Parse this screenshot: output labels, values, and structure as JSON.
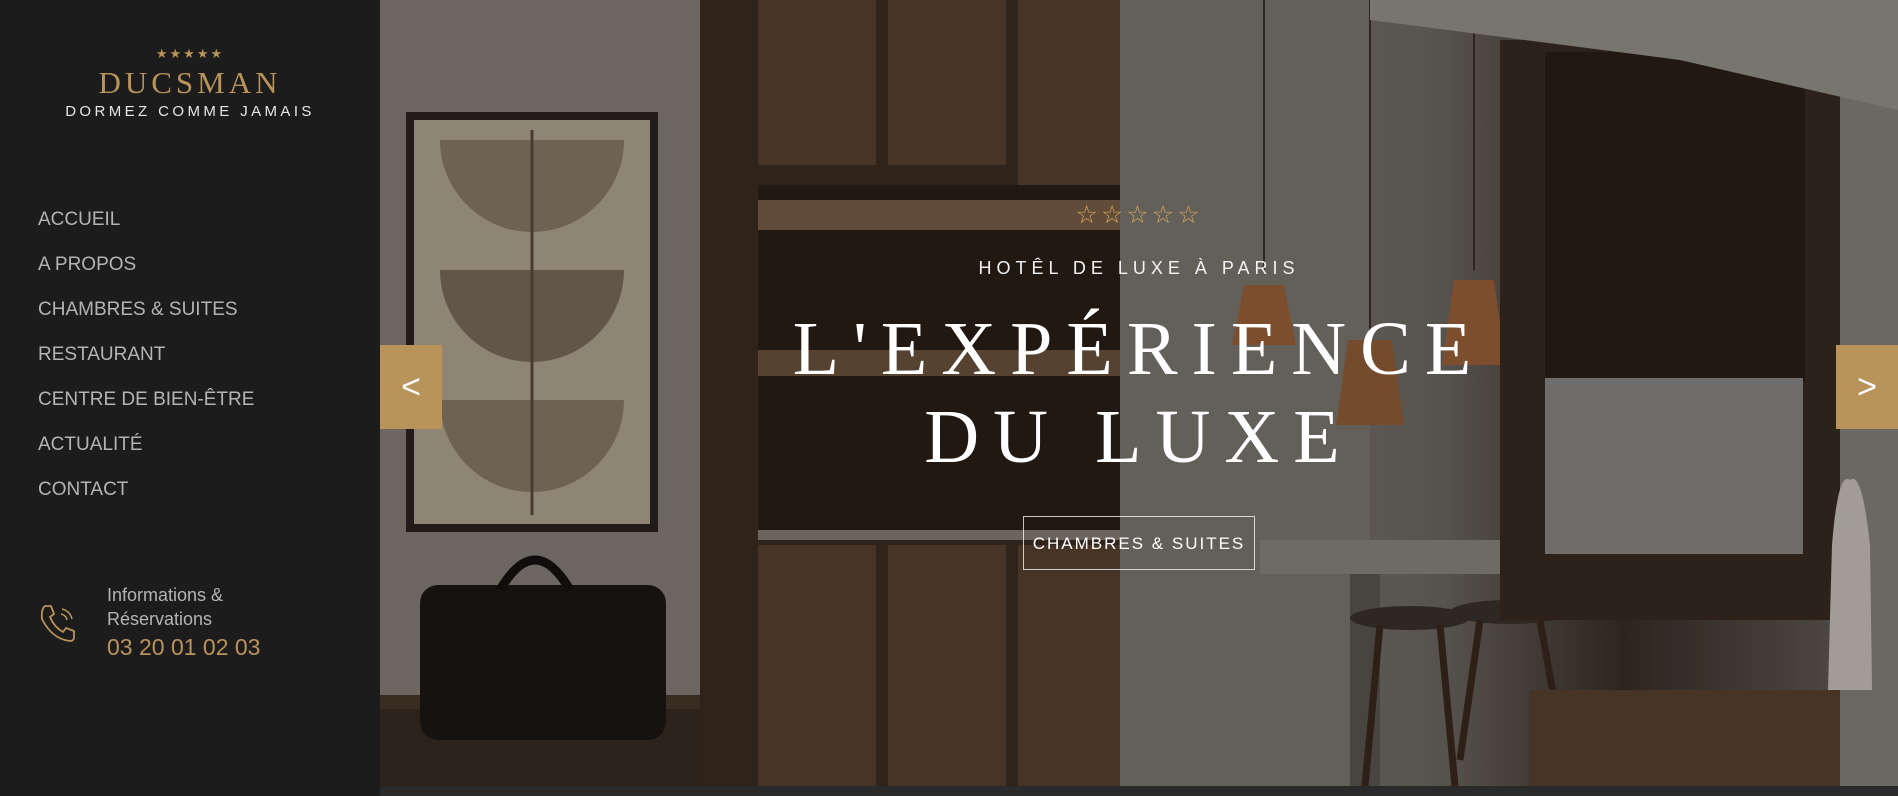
{
  "brand": {
    "stars": "★★★★★",
    "name": "DUCSMAN",
    "tagline": "DORMEZ COMME JAMAIS"
  },
  "nav": {
    "items": [
      {
        "label": "ACCUEIL"
      },
      {
        "label": "A PROPOS"
      },
      {
        "label": "CHAMBRES & SUITES"
      },
      {
        "label": "RESTAURANT"
      },
      {
        "label": "CENTRE DE BIEN-ÊTRE"
      },
      {
        "label": "ACTUALITÉ"
      },
      {
        "label": "CONTACT"
      }
    ]
  },
  "contact": {
    "label_line1": "Informations &",
    "label_line2": "Réservations",
    "phone": "03 20 01 02 03",
    "icon": "phone-icon"
  },
  "hero": {
    "stars": "☆☆☆☆☆",
    "subtitle": "HOTÊL DE LUXE À PARIS",
    "title_line1": "L'EXPÉRIENCE",
    "title_line2": "DU LUXE",
    "cta_label": "CHAMBRES & SUITES",
    "prev_label": "<",
    "next_label": ">"
  },
  "colors": {
    "accent": "#b8935a",
    "sidebar_bg": "#1c1c1c",
    "nav_text": "#b4b4b4"
  }
}
